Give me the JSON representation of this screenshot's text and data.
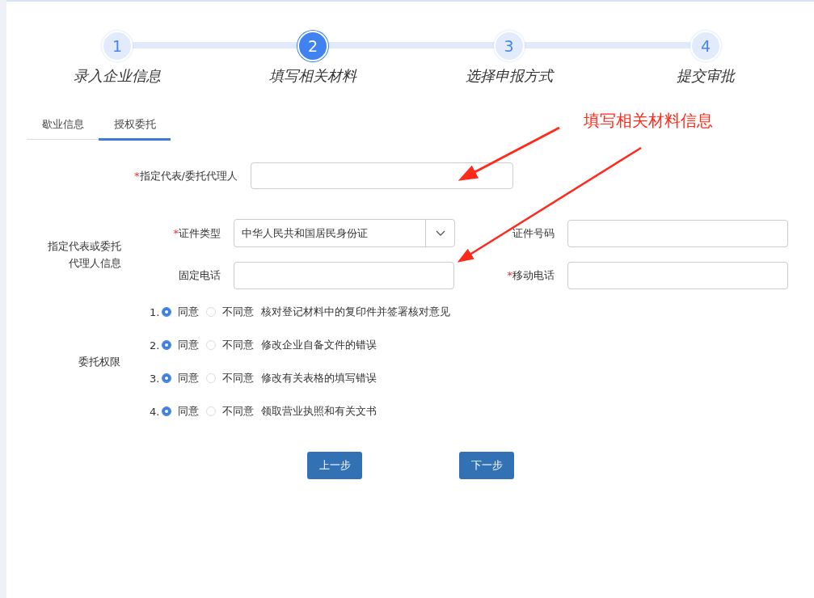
{
  "steps": [
    {
      "number": "1",
      "label": "录入企业信息",
      "selected": false
    },
    {
      "number": "2",
      "label": "填写相关材料",
      "selected": true
    },
    {
      "number": "3",
      "label": "选择申报方式",
      "selected": false
    },
    {
      "number": "4",
      "label": "提交审批",
      "selected": false
    }
  ],
  "tabs": [
    {
      "label": "歇业信息",
      "selected": false
    },
    {
      "label": "授权委托",
      "selected": true
    }
  ],
  "representative": {
    "label": "指定代表/委托代理人",
    "required_mark": "*"
  },
  "agent_group": {
    "label_lines": [
      "指定代表或委托",
      "代理人信息"
    ],
    "fields": [
      {
        "kind": "select",
        "label": "证件类型",
        "required_mark": "*",
        "value": "中华人民共和国居民身份证"
      },
      {
        "kind": "input",
        "label": "证件号码"
      },
      {
        "kind": "input",
        "label": "固定电话"
      },
      {
        "kind": "input",
        "label": "移动电话",
        "required_mark": "*"
      }
    ]
  },
  "permissions": {
    "label": "委托权限",
    "items": [
      {
        "number": "1.",
        "options": [
          {
            "label": "同意",
            "selected": true
          },
          {
            "label": "不同意",
            "selected": false
          }
        ],
        "text": "核对登记材料中的复印件并签署核对意见"
      },
      {
        "number": "2.",
        "options": [
          {
            "label": "同意",
            "selected": true
          },
          {
            "label": "不同意",
            "selected": false
          }
        ],
        "text": "修改企业自备文件的错误"
      },
      {
        "number": "3.",
        "options": [
          {
            "label": "同意",
            "selected": true
          },
          {
            "label": "不同意",
            "selected": false
          }
        ],
        "text": "修改有关表格的填写错误"
      },
      {
        "number": "4.",
        "options": [
          {
            "label": "同意",
            "selected": true
          },
          {
            "label": "不同意",
            "selected": false
          }
        ],
        "text": "领取营业执照和有关文书"
      }
    ]
  },
  "buttons": [
    "上一步",
    "下一步"
  ],
  "annotation": {
    "text": "填写相关材料信息"
  }
}
